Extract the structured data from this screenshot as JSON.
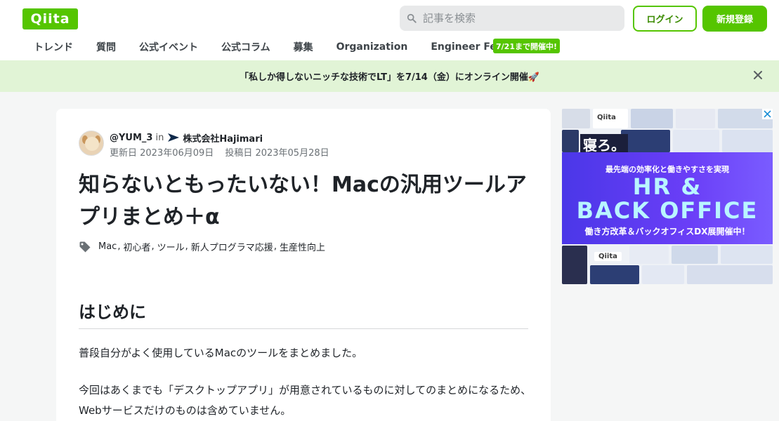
{
  "header": {
    "logo_text": "Qiita",
    "search_placeholder": "記事を検索",
    "login_label": "ログイン",
    "signup_label": "新規登録"
  },
  "nav": {
    "items": [
      {
        "label": "トレンド"
      },
      {
        "label": "質問"
      },
      {
        "label": "公式イベント"
      },
      {
        "label": "公式コラム"
      },
      {
        "label": "募集"
      },
      {
        "label": "Organization"
      },
      {
        "label": "Engineer Festa"
      }
    ],
    "badge": "7/21まで開催中!"
  },
  "banner": {
    "text": "「私しか得しないニッチな技術でLT」を7/14（金）にオンライン開催🚀"
  },
  "article": {
    "author": "@YUM_3",
    "in_label": "in",
    "organization": "株式会社Hajimari",
    "updated": "更新日 2023年06月09日",
    "posted": "投稿日 2023年05月28日",
    "title": "知らないともったいない！Macの汎用ツールアプリまとめ＋α",
    "tags": [
      "Mac",
      "初心者",
      "ツール",
      "新人プログラマ応援",
      "生産性向上"
    ],
    "tag_separator": ",",
    "heading": "はじめに",
    "paragraph1": "普段自分がよく使用しているMacのツールをまとめました。",
    "paragraph2": "今回はあくまでも「デスクトップアプリ」が用意されているものに対してのまとめになるため、Webサービスだけのものは含めていません。"
  },
  "ad": {
    "qiita_label": "Qiita",
    "neru": "寝ろ。",
    "subtitle": "最先端の効率化と働きやすさを実現",
    "big_line1": "HR &",
    "big_line2": "BACK OFFICE",
    "footer": "働き方改革＆バックオフィスDX展開催中！"
  },
  "colors": {
    "brand_green": "#55c500",
    "banner_bg": "#e1f4d6",
    "page_bg": "#f5f6f6",
    "ad_purple": "#5b3df5",
    "ad_cyan": "#b9f5ff"
  },
  "icons": [
    "search-icon",
    "close-icon",
    "tag-icon",
    "hajimari-logo-icon",
    "ad-close-icon"
  ]
}
